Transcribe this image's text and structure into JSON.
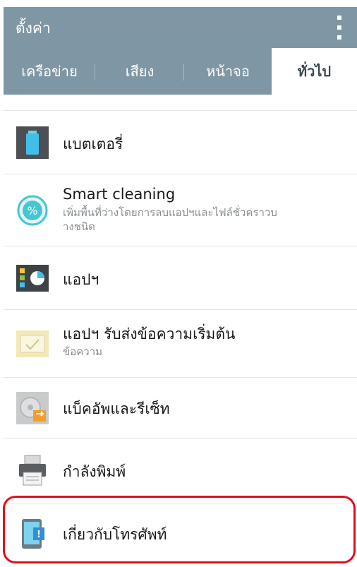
{
  "app": {
    "title": "ตั้งค่า",
    "menu_icon": "overflow-menu-icon"
  },
  "tabs": [
    {
      "label": "เครือข่าย",
      "selected": false
    },
    {
      "label": "เสียง",
      "selected": false
    },
    {
      "label": "หน้าจอ",
      "selected": false
    },
    {
      "label": "ทั่วไป",
      "selected": true
    }
  ],
  "items": [
    {
      "label": "แบตเตอรี่",
      "icon": "battery-icon"
    },
    {
      "label": "Smart cleaning",
      "subtitle_line1": "เพิ่มพื้นที่ว่างโดยการลบแอปฯและไฟล์ชั่วคราวบ",
      "subtitle_line2": "างชนิด",
      "icon": "smart-cleaning-icon"
    },
    {
      "label": "แอปฯ",
      "icon": "apps-icon"
    },
    {
      "label": "แอปฯ รับส่งข้อความเริ่มต้น",
      "subtitle": "ข้อความ",
      "icon": "message-app-icon"
    },
    {
      "label": "แบ็คอัพและรีเซ็ท",
      "icon": "backup-reset-icon"
    },
    {
      "label": "กำลังพิมพ์",
      "icon": "printer-icon"
    },
    {
      "label": "เกี่ยวกับโทรศัพท์",
      "icon": "about-phone-icon"
    }
  ],
  "colors": {
    "header": "#7f97a4",
    "highlight": "#e0101a",
    "accent_teal": "#45c7d3"
  }
}
